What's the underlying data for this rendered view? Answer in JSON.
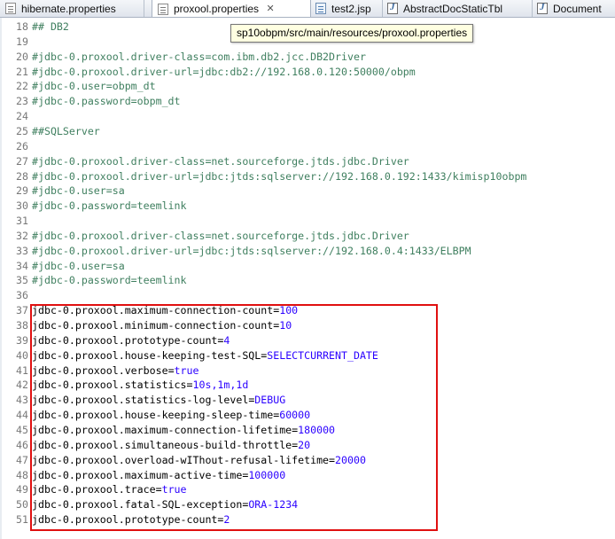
{
  "tabs": [
    {
      "label": "hibernate.properties",
      "icon": "properties-file-icon",
      "active": false
    },
    {
      "label": "proxool.properties",
      "icon": "properties-file-icon",
      "active": true
    },
    {
      "label": "test2.jsp",
      "icon": "jsp-file-icon",
      "active": false
    },
    {
      "label": "AbstractDocStaticTbl",
      "icon": "java-file-icon",
      "active": false
    },
    {
      "label": "Document",
      "icon": "java-file-icon",
      "active": false
    }
  ],
  "close_glyph": "✕",
  "tooltip": "sp10obpm/src/main/resources/proxool.properties",
  "lines": [
    {
      "n": "18",
      "comment": "## DB2"
    },
    {
      "n": "19",
      "comment": ""
    },
    {
      "n": "20",
      "comment": "#jdbc-0.proxool.driver-class=com.ibm.db2.jcc.DB2Driver"
    },
    {
      "n": "21",
      "comment": "#jdbc-0.proxool.driver-url=jdbc:db2://192.168.0.120:50000/obpm"
    },
    {
      "n": "22",
      "comment": "#jdbc-0.user=obpm_dt"
    },
    {
      "n": "23",
      "comment": "#jdbc-0.password=obpm_dt"
    },
    {
      "n": "24",
      "comment": ""
    },
    {
      "n": "25",
      "comment": "##SQLServer"
    },
    {
      "n": "26",
      "comment": ""
    },
    {
      "n": "27",
      "comment": "#jdbc-0.proxool.driver-class=net.sourceforge.jtds.jdbc.Driver"
    },
    {
      "n": "28",
      "comment": "#jdbc-0.proxool.driver-url=jdbc:jtds:sqlserver://192.168.0.192:1433/kimisp10obpm"
    },
    {
      "n": "29",
      "comment": "#jdbc-0.user=sa"
    },
    {
      "n": "30",
      "comment": "#jdbc-0.password=teemlink"
    },
    {
      "n": "31",
      "comment": ""
    },
    {
      "n": "32",
      "comment": "#jdbc-0.proxool.driver-class=net.sourceforge.jtds.jdbc.Driver"
    },
    {
      "n": "33",
      "comment": "#jdbc-0.proxool.driver-url=jdbc:jtds:sqlserver://192.168.0.4:1433/ELBPM"
    },
    {
      "n": "34",
      "comment": "#jdbc-0.user=sa"
    },
    {
      "n": "35",
      "comment": "#jdbc-0.password=teemlink"
    },
    {
      "n": "36",
      "comment": ""
    },
    {
      "n": "37",
      "key": "jdbc-0.proxool.maximum-connection-count",
      "value": "100"
    },
    {
      "n": "38",
      "key": "jdbc-0.proxool.minimum-connection-count",
      "value": "10"
    },
    {
      "n": "39",
      "key": "jdbc-0.proxool.prototype-count",
      "value": "4"
    },
    {
      "n": "40",
      "key": "jdbc-0.proxool.house-keeping-test-SQL",
      "value": "SELECTCURRENT_DATE"
    },
    {
      "n": "41",
      "key": "jdbc-0.proxool.verbose",
      "value": "true"
    },
    {
      "n": "42",
      "key": "jdbc-0.proxool.statistics",
      "value": "10s,1m,1d"
    },
    {
      "n": "43",
      "key": "jdbc-0.proxool.statistics-log-level",
      "value": "DEBUG"
    },
    {
      "n": "44",
      "key": "jdbc-0.proxool.house-keeping-sleep-time",
      "value": "60000"
    },
    {
      "n": "45",
      "key": "jdbc-0.proxool.maximum-connection-lifetime",
      "value": "180000"
    },
    {
      "n": "46",
      "key": "jdbc-0.proxool.simultaneous-build-throttle",
      "value": "20"
    },
    {
      "n": "47",
      "key": "jdbc-0.proxool.overload-wIThout-refusal-lifetime",
      "value": "20000"
    },
    {
      "n": "48",
      "key": "jdbc-0.proxool.maximum-active-time",
      "value": "100000"
    },
    {
      "n": "49",
      "key": "jdbc-0.proxool.trace",
      "value": "true"
    },
    {
      "n": "50",
      "key": "jdbc-0.proxool.fatal-SQL-exception",
      "value": "ORA-1234"
    },
    {
      "n": "51",
      "key": "jdbc-0.proxool.prototype-count",
      "value": "2"
    }
  ],
  "colors": {
    "comment": "#3f7f5f",
    "value": "#2a00ff",
    "line_number": "#787878",
    "highlight_box": "#e01010",
    "tooltip_bg": "#ffffe1"
  }
}
